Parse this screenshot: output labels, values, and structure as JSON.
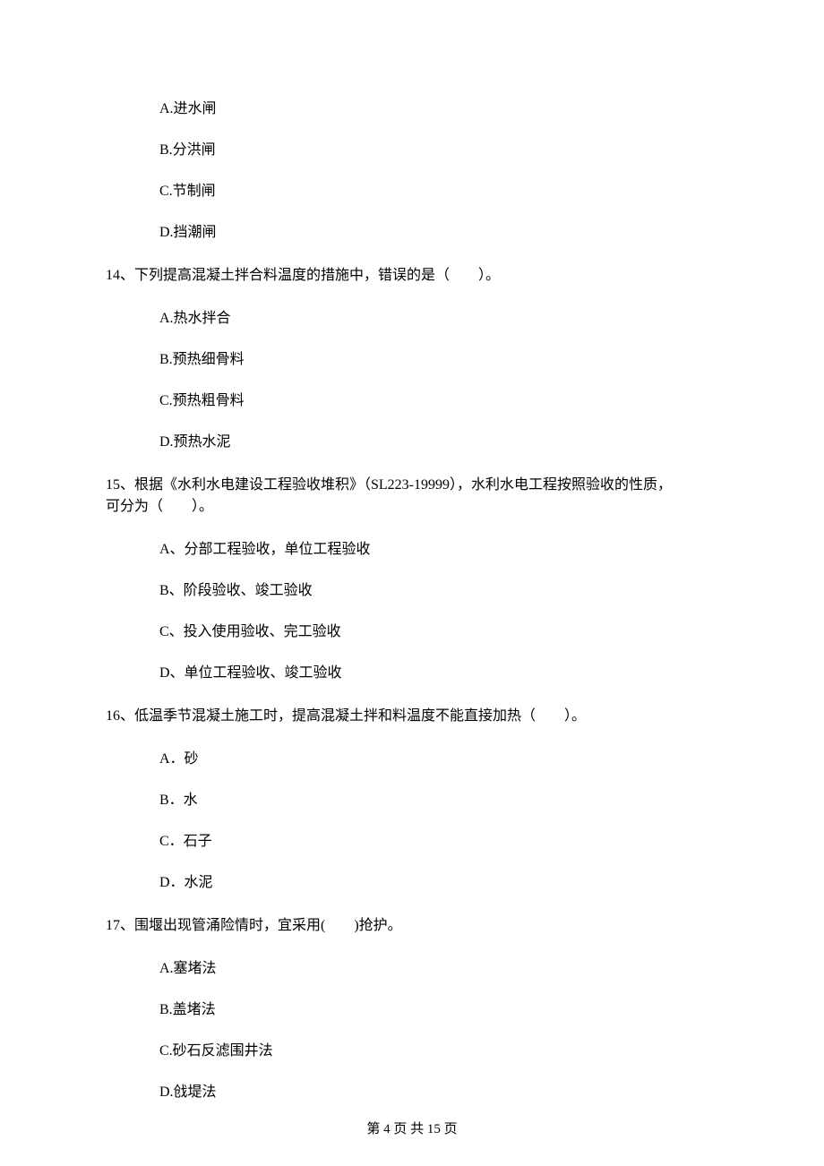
{
  "q13_options": {
    "A": "A.进水闸",
    "B": "B.分洪闸",
    "C": "C.节制闸",
    "D": "D.挡潮闸"
  },
  "q14": {
    "stem": "14、下列提高混凝土拌合料温度的措施中，错误的是（　　）。",
    "options": {
      "A": "A.热水拌合",
      "B": "B.预热细骨料",
      "C": "C.预热粗骨料",
      "D": "D.预热水泥"
    }
  },
  "q15": {
    "stem_line1": "15、根据《水利水电建设工程验收堆积》（SL223-19999），水利水电工程按照验收的性质，",
    "stem_line2": "可分为（　　）。",
    "options": {
      "A": "A、分部工程验收，单位工程验收",
      "B": "B、阶段验收、竣工验收",
      "C": "C、投入使用验收、完工验收",
      "D": "D、单位工程验收、竣工验收"
    }
  },
  "q16": {
    "stem": "16、低温季节混凝土施工时，提高混凝土拌和料温度不能直接加热（　　）。",
    "options": {
      "A": "A．砂",
      "B": "B．水",
      "C": "C．石子",
      "D": "D．水泥"
    }
  },
  "q17": {
    "stem": "17、围堰出现管涌险情时，宜采用(　　)抢护。",
    "options": {
      "A": "A.塞堵法",
      "B": "B.盖堵法",
      "C": "C.砂石反滤围井法",
      "D": "D.戗堤法"
    }
  },
  "footer": "第 4 页 共 15 页"
}
